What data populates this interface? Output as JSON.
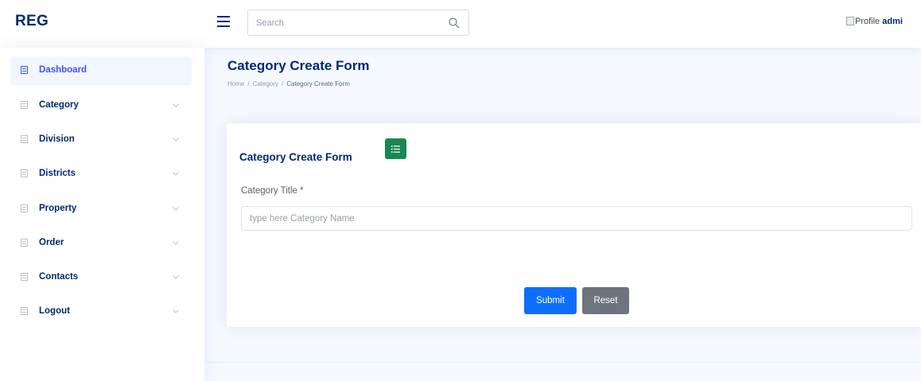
{
  "header": {
    "logo": "REG",
    "search": {
      "placeholder": "Search"
    },
    "profile": {
      "alt_text": "Profile",
      "name": "admi"
    }
  },
  "sidebar": {
    "items": [
      {
        "label": "Dashboard",
        "active": true
      },
      {
        "label": "Category",
        "has_submenu": true
      },
      {
        "label": "Division",
        "has_submenu": true
      },
      {
        "label": "Districts",
        "has_submenu": true
      },
      {
        "label": "Property",
        "has_submenu": true
      },
      {
        "label": "Order",
        "has_submenu": true
      },
      {
        "label": "Contacts",
        "has_submenu": true
      },
      {
        "label": "Logout",
        "has_submenu": true
      }
    ]
  },
  "page": {
    "title": "Category Create Form",
    "breadcrumb": [
      "Home",
      "Category",
      "Category Create Form"
    ]
  },
  "form": {
    "card_title": "Category Create Form",
    "field_label": "Category Title *",
    "field_placeholder": "type here Category Name",
    "field_value": "",
    "submit_label": "Submit",
    "reset_label": "Reset"
  },
  "colors": {
    "brand_navy": "#012970",
    "accent_blue": "#4154f1",
    "submit_blue": "#0d6efd",
    "reset_gray": "#6c757d",
    "list_button_green": "#198754"
  },
  "icons": {
    "menu_toggle": "hamburger-icon",
    "search": "search-icon",
    "nav_item": "list-icon",
    "submenu": "chevron-down-icon",
    "card_button": "list-icon"
  }
}
